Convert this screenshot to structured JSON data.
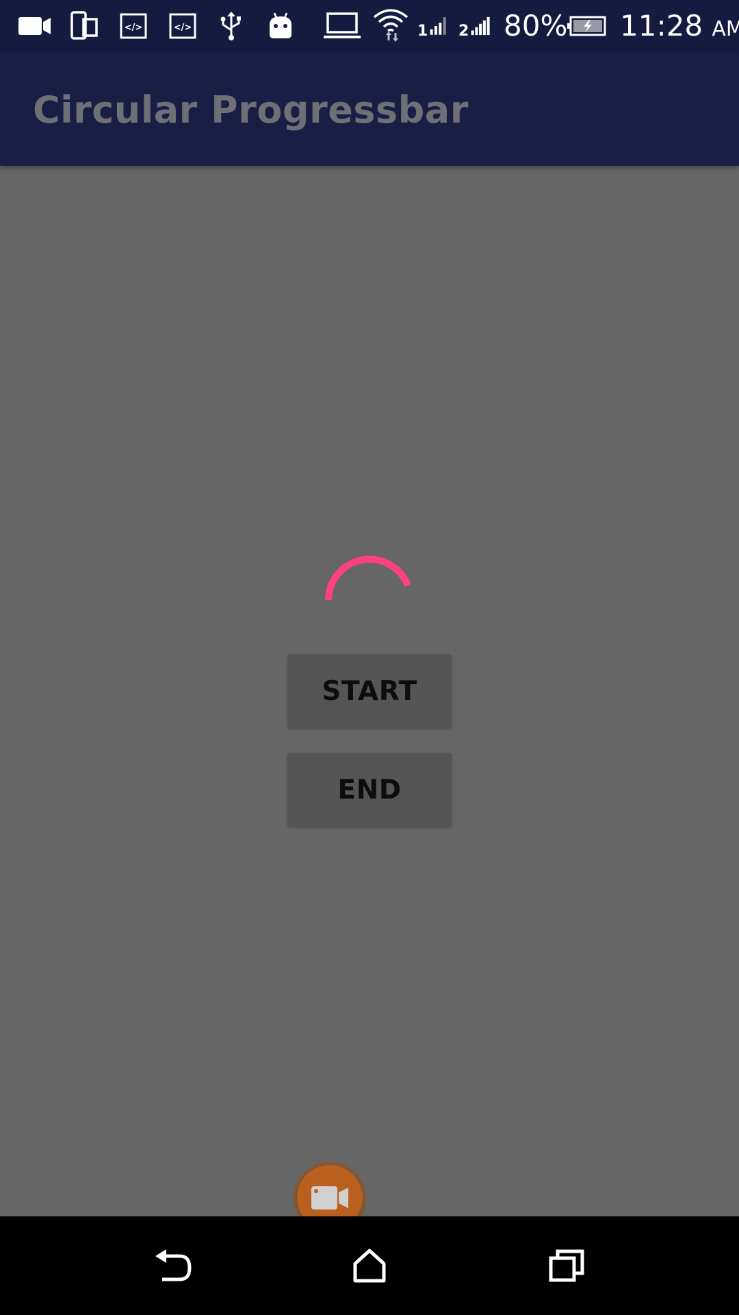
{
  "status_bar": {
    "icons": [
      "video-camera-icon",
      "phone-tablet-icon",
      "code-icon",
      "code-icon",
      "usb-icon",
      "android-debug-icon",
      "laptop-icon",
      "wifi-icon",
      "signal-sim1-icon",
      "signal-sim2-icon",
      "battery-charging-icon"
    ],
    "sim1_label": "1",
    "sim2_label": "2",
    "battery_percent": "80%",
    "time": "11:28",
    "ampm": "AM"
  },
  "app_bar": {
    "title": "Circular Progressbar"
  },
  "main": {
    "spinner": {
      "icon": "circular-progress-indicator",
      "color": "#ff4081"
    },
    "start_label": "START",
    "end_label": "END"
  },
  "overlay": {
    "icon": "video-camera-icon",
    "color": "#b9601f"
  },
  "navigation": {
    "items": [
      "back-icon",
      "home-icon",
      "recent-apps-icon"
    ]
  },
  "colors": {
    "status_bar": "#151a3f",
    "app_bar": "#191e45",
    "background": "#666666",
    "button": "#555555",
    "accent": "#ff4081"
  }
}
